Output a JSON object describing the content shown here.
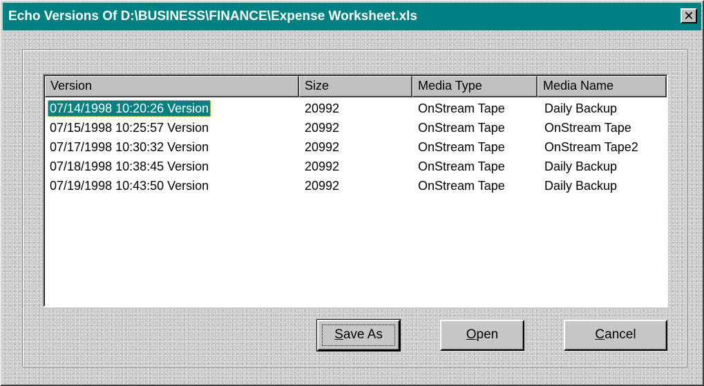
{
  "window": {
    "title": "Echo Versions Of  D:\\BUSINESS\\FINANCE\\Expense Worksheet.xls",
    "close_glyph": "✕"
  },
  "list": {
    "columns": [
      "Version",
      "Size",
      "Media Type",
      "Media Name"
    ],
    "rows": [
      {
        "version": "07/14/1998 10:20:26 Version",
        "size": "20992",
        "media_type": "OnStream Tape",
        "media_name": "Daily Backup",
        "selected": true
      },
      {
        "version": "07/15/1998 10:25:57 Version",
        "size": "20992",
        "media_type": "OnStream Tape",
        "media_name": "OnStream Tape"
      },
      {
        "version": "07/17/1998 10:30:32 Version",
        "size": "20992",
        "media_type": "OnStream Tape",
        "media_name": "OnStream Tape2"
      },
      {
        "version": "07/18/1998 10:38:45 Version",
        "size": "20992",
        "media_type": "OnStream Tape",
        "media_name": "Daily Backup"
      },
      {
        "version": "07/19/1998 10:43:50 Version",
        "size": "20992",
        "media_type": "OnStream Tape",
        "media_name": "Daily Backup"
      }
    ]
  },
  "buttons": {
    "save_as": {
      "mnemonic": "S",
      "rest": "ave As"
    },
    "open": {
      "mnemonic": "O",
      "rest": "pen"
    },
    "cancel": {
      "mnemonic": "C",
      "rest": "ancel"
    }
  },
  "colors": {
    "title_bar": "#008080",
    "selection": "#008080",
    "dialog_face": "#c6c6c6"
  }
}
